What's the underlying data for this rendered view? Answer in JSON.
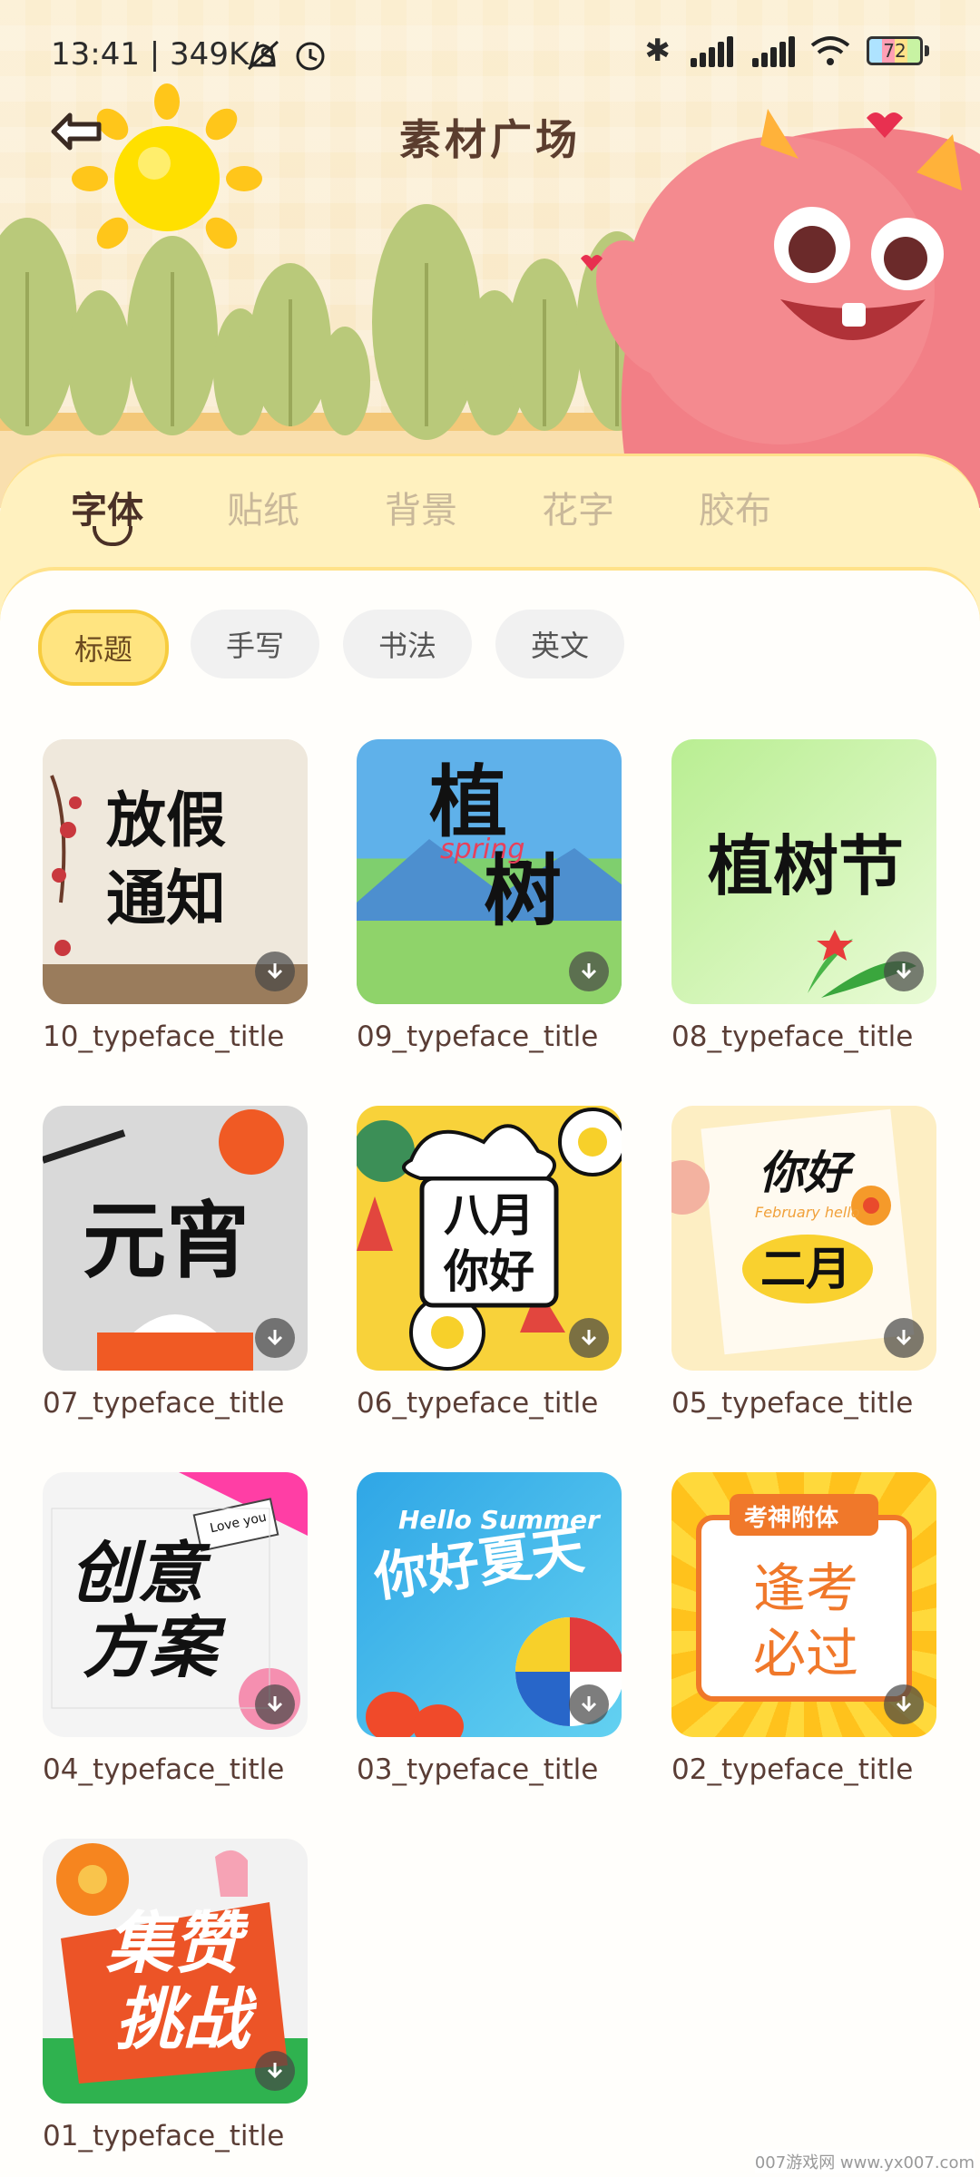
{
  "status_bar": {
    "time_speed": "13:41 | 349K/s",
    "battery": "72"
  },
  "header": {
    "title": "素材广场"
  },
  "tabs": [
    {
      "label": "字体",
      "active": true
    },
    {
      "label": "贴纸",
      "active": false
    },
    {
      "label": "背景",
      "active": false
    },
    {
      "label": "花字",
      "active": false
    },
    {
      "label": "胶布",
      "active": false
    }
  ],
  "filters": [
    {
      "label": "标题",
      "active": true
    },
    {
      "label": "手写",
      "active": false
    },
    {
      "label": "书法",
      "active": false
    },
    {
      "label": "英文",
      "active": false
    }
  ],
  "items": [
    {
      "label": "10_typeface_title",
      "art_text": [
        "放假",
        "通知"
      ]
    },
    {
      "label": "09_typeface_title",
      "art_text": [
        "植",
        "树"
      ],
      "art_sub": "spring"
    },
    {
      "label": "08_typeface_title",
      "art_text": [
        "植树节"
      ]
    },
    {
      "label": "07_typeface_title",
      "art_text": [
        "元宵"
      ]
    },
    {
      "label": "06_typeface_title",
      "art_text": [
        "八月",
        "你好"
      ]
    },
    {
      "label": "05_typeface_title",
      "art_text": [
        "你好",
        "二月"
      ],
      "art_sub": "February hello"
    },
    {
      "label": "04_typeface_title",
      "art_text": [
        "创意",
        "方案"
      ],
      "art_sub": "Love you"
    },
    {
      "label": "03_typeface_title",
      "art_text": [
        "你好夏天"
      ],
      "art_sub": "Hello Summer"
    },
    {
      "label": "02_typeface_title",
      "art_text": [
        "逢考",
        "必过"
      ],
      "art_sub": "考神附体"
    },
    {
      "label": "01_typeface_title",
      "art_text": [
        "集赞",
        "挑战"
      ]
    }
  ],
  "watermark": "007游戏网 www.yx007.com"
}
